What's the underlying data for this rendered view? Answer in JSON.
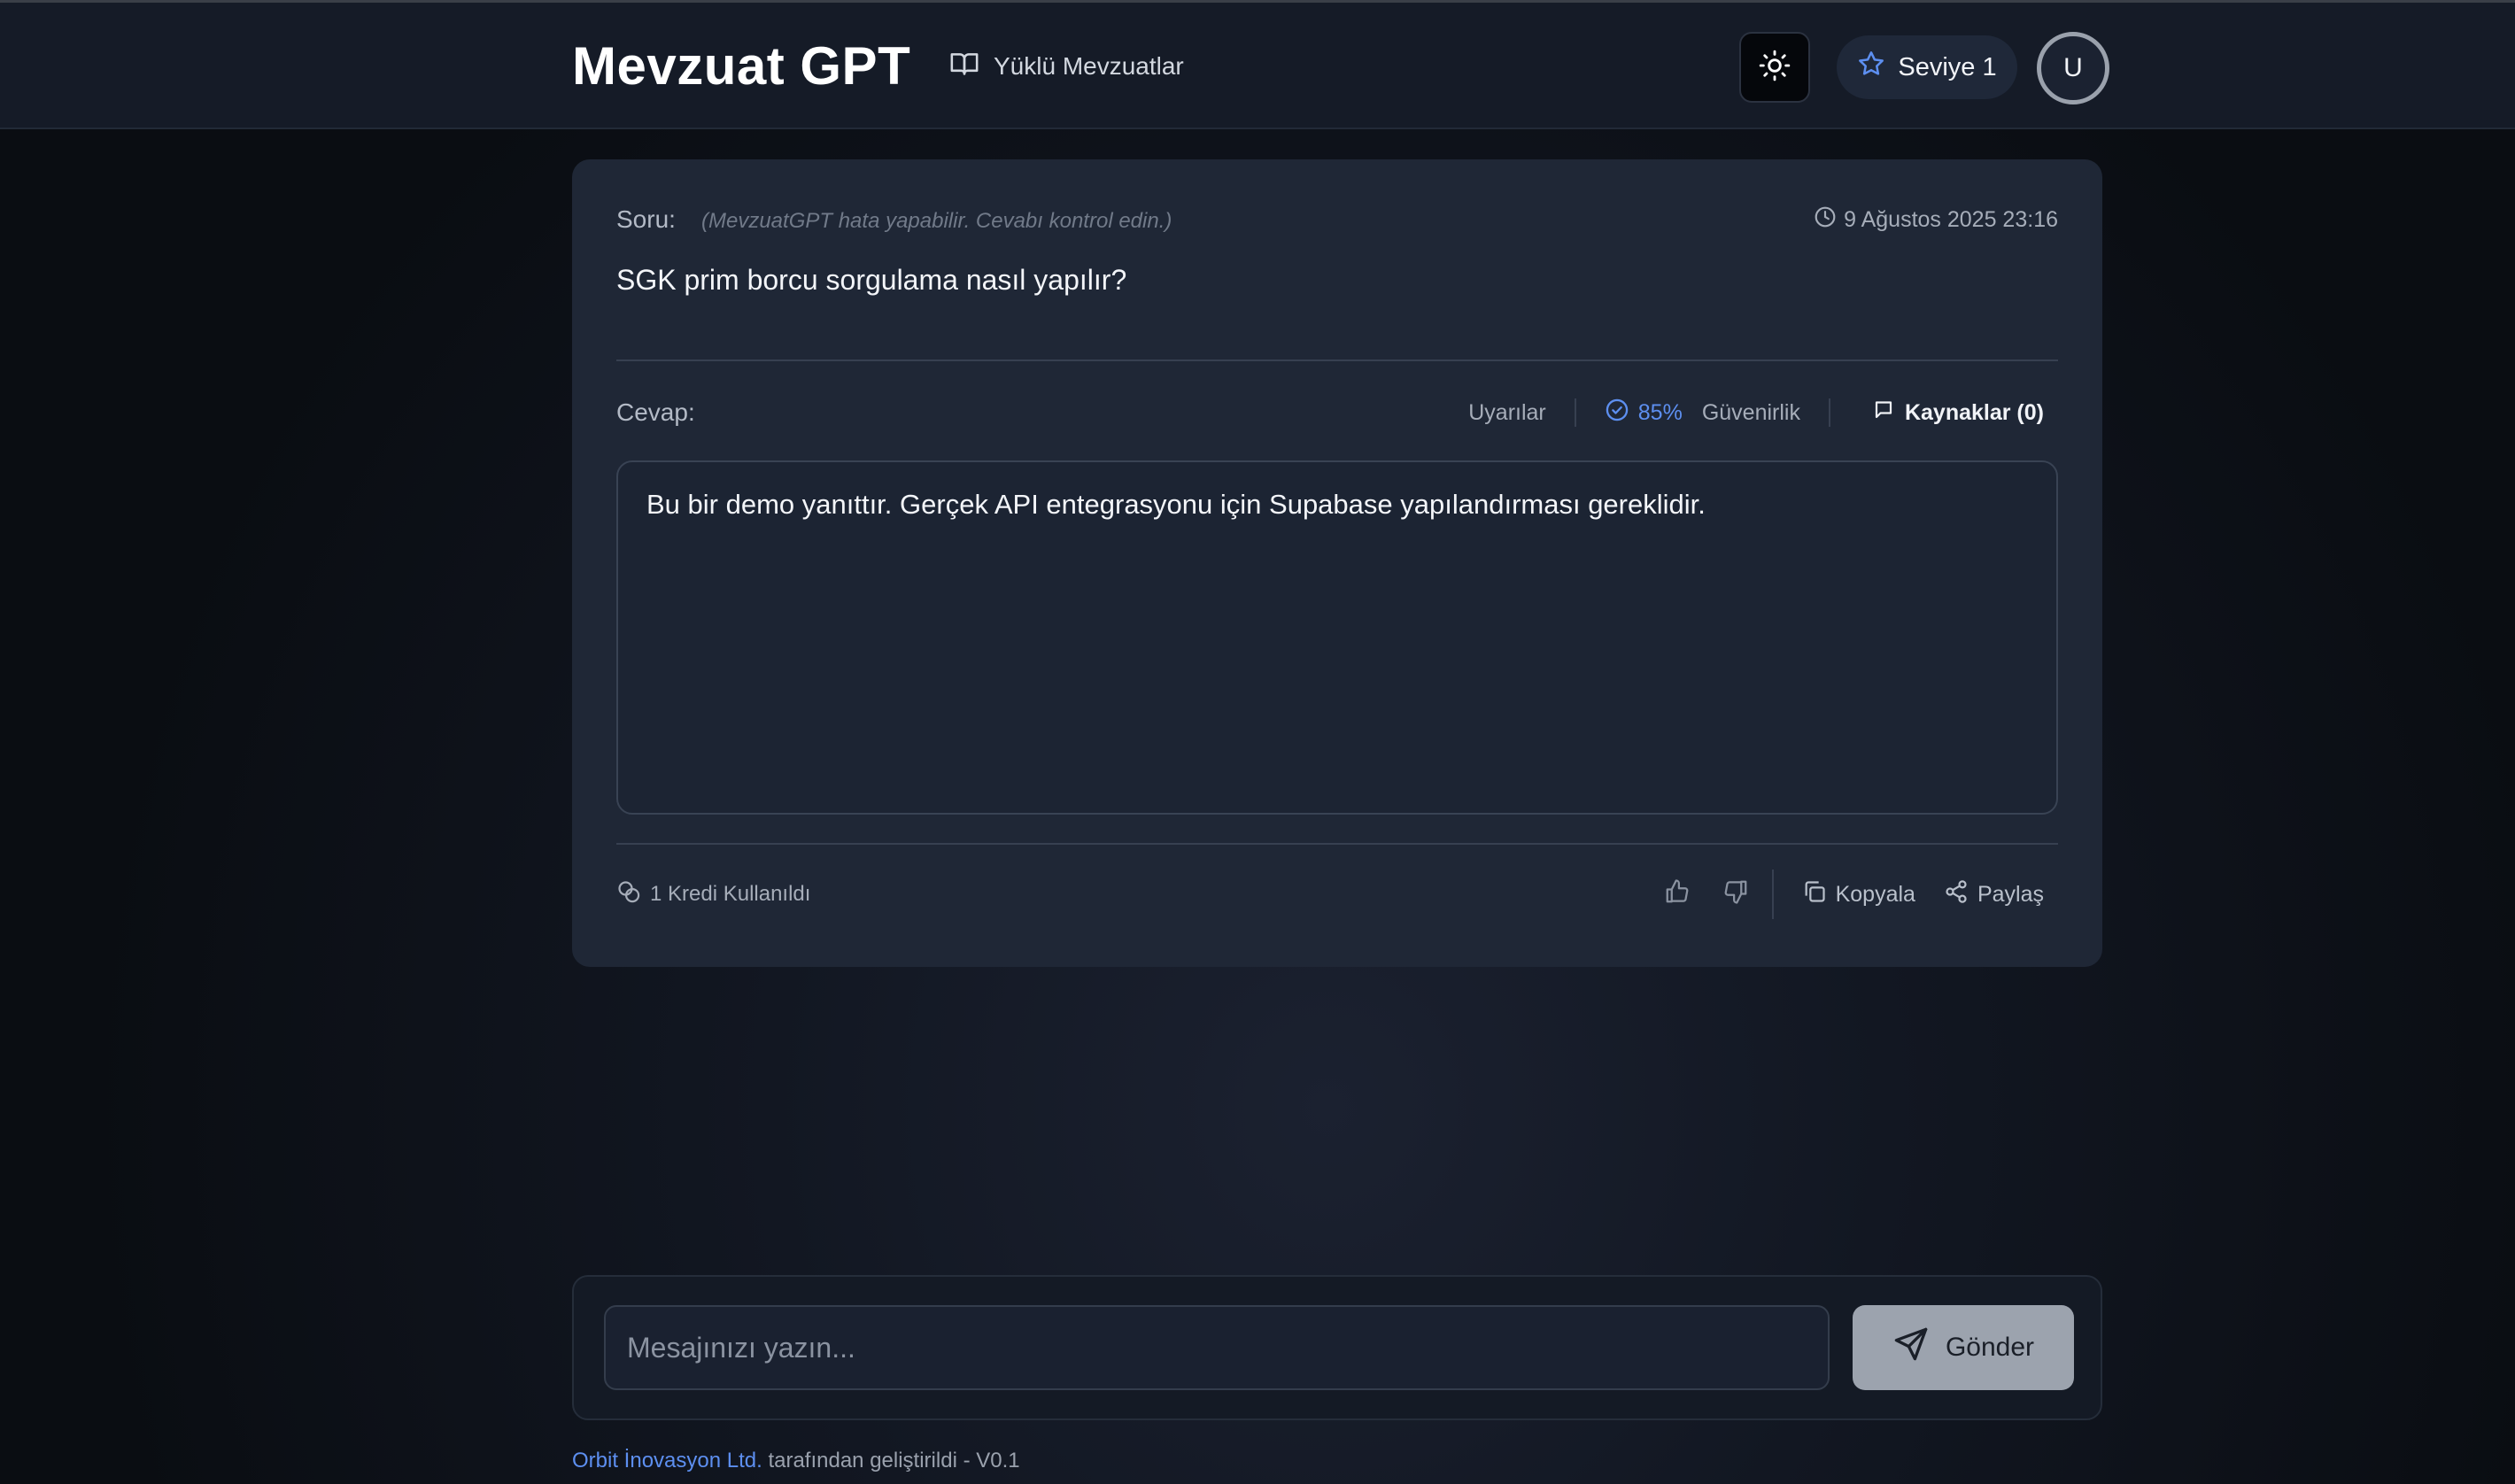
{
  "header": {
    "brand": "Mevzuat GPT",
    "nav_link": "Yüklü Mevzuatlar",
    "theme_icon": "sun-icon",
    "level_label": "Seviye 1",
    "avatar_initial": "U"
  },
  "question": {
    "label": "Soru:",
    "disclaimer": "(MevzuatGPT hata yapabilir. Cevabı kontrol edin.)",
    "timestamp": "9 Ağustos 2025 23:16",
    "text": "SGK prim borcu sorgulama nasıl yapılır?"
  },
  "answer": {
    "label": "Cevap:",
    "warnings_label": "Uyarılar",
    "confidence_value": "85%",
    "confidence_label": "Güvenirlik",
    "sources_label": "Kaynaklar (0)",
    "text": "Bu bir demo yanıttır. Gerçek API entegrasyonu için Supabase yapılandırması gereklidir."
  },
  "answer_footer": {
    "credits_label": "1 Kredi Kullanıldı",
    "copy_label": "Kopyala",
    "share_label": "Paylaş"
  },
  "composer": {
    "placeholder": "Mesajınızı yazın...",
    "value": "",
    "send_label": "Gönder"
  },
  "footer": {
    "company": "Orbit İnovasyon Ltd.",
    "suffix": " tarafından geliştirildi - V0.1"
  },
  "colors": {
    "accent": "#5d8ff0",
    "card_bg": "#1f2736",
    "header_bg": "#151b27",
    "send_button_bg": "#9ca3ae"
  }
}
